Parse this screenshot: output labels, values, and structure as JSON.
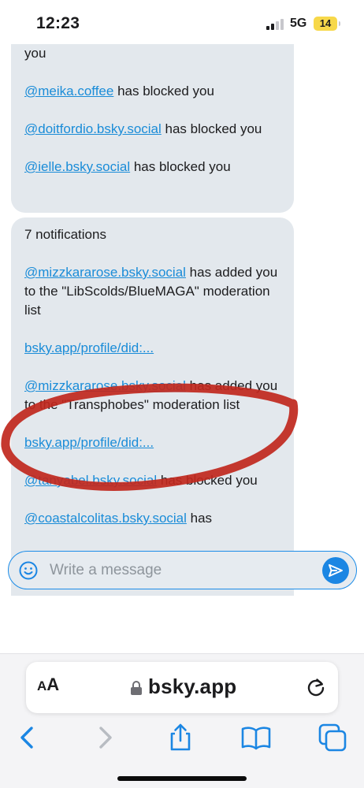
{
  "status_bar": {
    "time": "12:23",
    "network": "5G",
    "battery": "14"
  },
  "thread": {
    "bubble1": {
      "lines": [
        {
          "handle": "",
          "text": "you"
        },
        {
          "handle": "@meika.coffee",
          "text": " has blocked you"
        },
        {
          "handle": "@doitfordio.bsky.social",
          "text": " has blocked you"
        },
        {
          "handle": "@ielle.bsky.social",
          "text": " has blocked you"
        }
      ]
    },
    "bubble2": {
      "header": "7 notifications",
      "item1_handle": "@mizzkararose.bsky.social",
      "item1_text": " has added you to the \"LibScolds/BlueMAGA\" moderation list",
      "item1_link": "bsky.app/profile/did:...",
      "item2_handle": "@mizzkararose.bsky.social",
      "item2_text": " has added you to the \"Transphobes\" moderation list",
      "item2_link": "bsky.app/profile/did:...",
      "item3_handle": "@tanyabel.bsky.social",
      "item3_text": " has blocked you",
      "item4_handle": "@coastalcolitas.bsky.social",
      "item4_text": " has"
    }
  },
  "composer": {
    "placeholder": "Write a message"
  },
  "browser": {
    "aa_large": "A",
    "aa_small": "A",
    "url": "bsky.app"
  },
  "colors": {
    "accent": "#1b86e3",
    "link": "#1a8cd8",
    "bubble": "#e3e8ed",
    "annotation": "#c0271d"
  },
  "icons": [
    "emoji-icon",
    "send-icon",
    "lock-icon",
    "reload-icon",
    "back-icon",
    "forward-icon",
    "share-icon",
    "bookmarks-icon",
    "tabs-icon"
  ]
}
